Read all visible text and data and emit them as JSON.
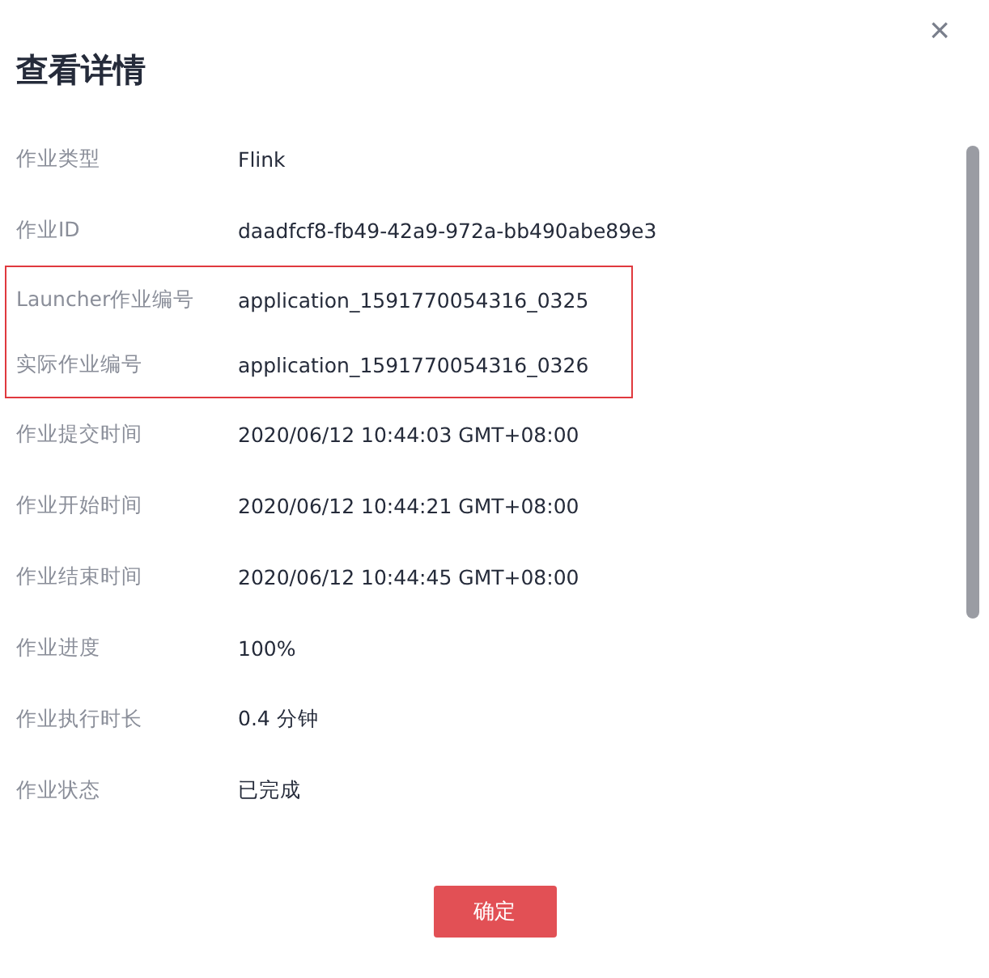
{
  "dialog": {
    "title": "查看详情",
    "close": "×",
    "rows": [
      {
        "label": "作业类型",
        "value": "Flink",
        "highlighted": false
      },
      {
        "label": "作业ID",
        "value": "daadfcf8-fb49-42a9-972a-bb490abe89e3",
        "highlighted": false
      },
      {
        "label": "Launcher作业编号",
        "value": "application_1591770054316_0325",
        "highlighted": true
      },
      {
        "label": "实际作业编号",
        "value": "application_1591770054316_0326",
        "highlighted": true
      },
      {
        "label": "作业提交时间",
        "value": "2020/06/12 10:44:03 GMT+08:00",
        "highlighted": false
      },
      {
        "label": "作业开始时间",
        "value": "2020/06/12 10:44:21 GMT+08:00",
        "highlighted": false
      },
      {
        "label": "作业结束时间",
        "value": "2020/06/12 10:44:45 GMT+08:00",
        "highlighted": false
      },
      {
        "label": "作业进度",
        "value": "100%",
        "highlighted": false
      },
      {
        "label": "作业执行时长",
        "value": "0.4 分钟",
        "highlighted": false
      },
      {
        "label": "作业状态",
        "value": "已完成",
        "highlighted": false
      }
    ],
    "button": "确定"
  }
}
